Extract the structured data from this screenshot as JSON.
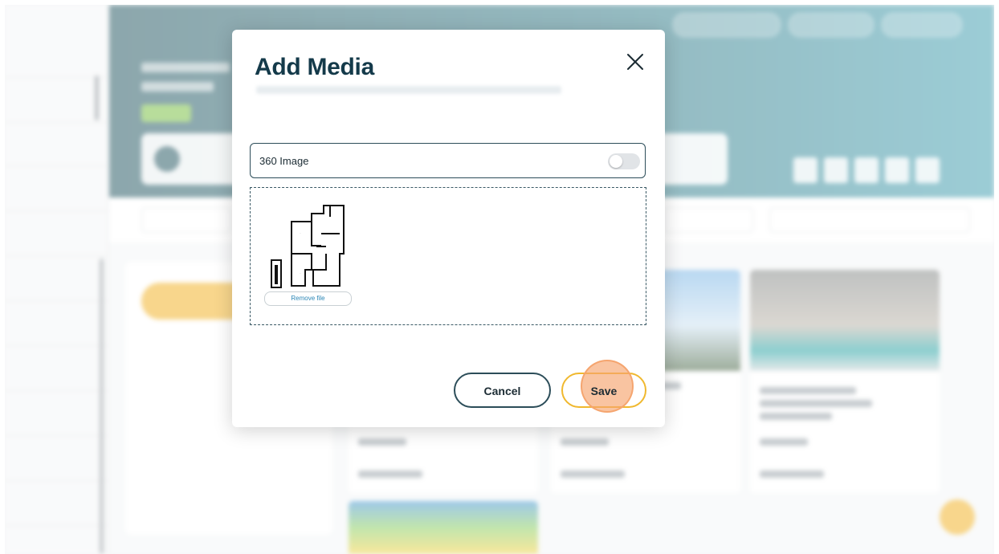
{
  "modal": {
    "title": "Add Media",
    "toggle_label": "360 Image",
    "toggle_on": false,
    "remove_file_label": "Remove file",
    "cancel_label": "Cancel",
    "save_label": "Save"
  },
  "colors": {
    "accent": "#f0b82e",
    "brand": "#2f5f69",
    "title": "#143a4a",
    "link": "#2b86b6"
  },
  "icons": {
    "close": "close-icon",
    "file_thumbnail": "floor-plan-thumbnail"
  }
}
